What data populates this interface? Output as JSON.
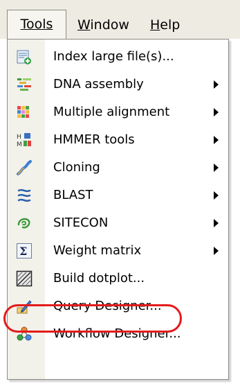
{
  "menubar": {
    "tools": "Tools",
    "window_first": "W",
    "window_rest": "indow",
    "help_first": "H",
    "help_rest": "elp"
  },
  "menu": {
    "items": [
      {
        "label": "Index large file(s)...",
        "icon": "index-icon",
        "submenu": false
      },
      {
        "label": "DNA assembly",
        "icon": "dna-assembly-icon",
        "submenu": true
      },
      {
        "label": "Multiple alignment",
        "icon": "alignment-icon",
        "submenu": true
      },
      {
        "label": "HMMER tools",
        "icon": "hmmer-icon",
        "submenu": true
      },
      {
        "label": "Cloning",
        "icon": "cloning-icon",
        "submenu": true
      },
      {
        "label": "BLAST",
        "icon": "blast-icon",
        "submenu": true
      },
      {
        "label": "SITECON",
        "icon": "sitecon-icon",
        "submenu": true
      },
      {
        "label": "Weight matrix",
        "icon": "sigma-icon",
        "submenu": true
      },
      {
        "label": "Build dotplot...",
        "icon": "dotplot-icon",
        "submenu": false
      },
      {
        "label": "Query Designer...",
        "icon": "query-designer-icon",
        "submenu": false
      },
      {
        "label": "Workflow Designer...",
        "icon": "workflow-icon",
        "submenu": false
      }
    ]
  },
  "highlight_color": "#e31a1a"
}
